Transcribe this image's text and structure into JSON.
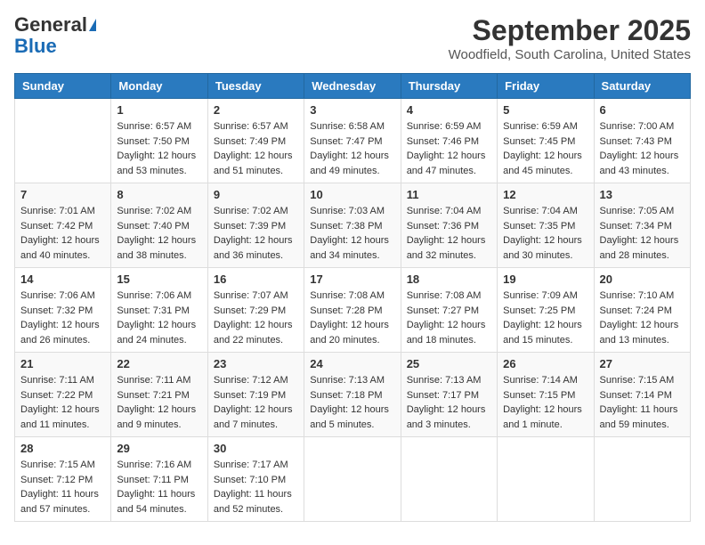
{
  "header": {
    "logo_general": "General",
    "logo_blue": "Blue",
    "month": "September 2025",
    "location": "Woodfield, South Carolina, United States"
  },
  "days_of_week": [
    "Sunday",
    "Monday",
    "Tuesday",
    "Wednesday",
    "Thursday",
    "Friday",
    "Saturday"
  ],
  "weeks": [
    [
      {
        "day": "",
        "info": ""
      },
      {
        "day": "1",
        "info": "Sunrise: 6:57 AM\nSunset: 7:50 PM\nDaylight: 12 hours\nand 53 minutes."
      },
      {
        "day": "2",
        "info": "Sunrise: 6:57 AM\nSunset: 7:49 PM\nDaylight: 12 hours\nand 51 minutes."
      },
      {
        "day": "3",
        "info": "Sunrise: 6:58 AM\nSunset: 7:47 PM\nDaylight: 12 hours\nand 49 minutes."
      },
      {
        "day": "4",
        "info": "Sunrise: 6:59 AM\nSunset: 7:46 PM\nDaylight: 12 hours\nand 47 minutes."
      },
      {
        "day": "5",
        "info": "Sunrise: 6:59 AM\nSunset: 7:45 PM\nDaylight: 12 hours\nand 45 minutes."
      },
      {
        "day": "6",
        "info": "Sunrise: 7:00 AM\nSunset: 7:43 PM\nDaylight: 12 hours\nand 43 minutes."
      }
    ],
    [
      {
        "day": "7",
        "info": "Sunrise: 7:01 AM\nSunset: 7:42 PM\nDaylight: 12 hours\nand 40 minutes."
      },
      {
        "day": "8",
        "info": "Sunrise: 7:02 AM\nSunset: 7:40 PM\nDaylight: 12 hours\nand 38 minutes."
      },
      {
        "day": "9",
        "info": "Sunrise: 7:02 AM\nSunset: 7:39 PM\nDaylight: 12 hours\nand 36 minutes."
      },
      {
        "day": "10",
        "info": "Sunrise: 7:03 AM\nSunset: 7:38 PM\nDaylight: 12 hours\nand 34 minutes."
      },
      {
        "day": "11",
        "info": "Sunrise: 7:04 AM\nSunset: 7:36 PM\nDaylight: 12 hours\nand 32 minutes."
      },
      {
        "day": "12",
        "info": "Sunrise: 7:04 AM\nSunset: 7:35 PM\nDaylight: 12 hours\nand 30 minutes."
      },
      {
        "day": "13",
        "info": "Sunrise: 7:05 AM\nSunset: 7:34 PM\nDaylight: 12 hours\nand 28 minutes."
      }
    ],
    [
      {
        "day": "14",
        "info": "Sunrise: 7:06 AM\nSunset: 7:32 PM\nDaylight: 12 hours\nand 26 minutes."
      },
      {
        "day": "15",
        "info": "Sunrise: 7:06 AM\nSunset: 7:31 PM\nDaylight: 12 hours\nand 24 minutes."
      },
      {
        "day": "16",
        "info": "Sunrise: 7:07 AM\nSunset: 7:29 PM\nDaylight: 12 hours\nand 22 minutes."
      },
      {
        "day": "17",
        "info": "Sunrise: 7:08 AM\nSunset: 7:28 PM\nDaylight: 12 hours\nand 20 minutes."
      },
      {
        "day": "18",
        "info": "Sunrise: 7:08 AM\nSunset: 7:27 PM\nDaylight: 12 hours\nand 18 minutes."
      },
      {
        "day": "19",
        "info": "Sunrise: 7:09 AM\nSunset: 7:25 PM\nDaylight: 12 hours\nand 15 minutes."
      },
      {
        "day": "20",
        "info": "Sunrise: 7:10 AM\nSunset: 7:24 PM\nDaylight: 12 hours\nand 13 minutes."
      }
    ],
    [
      {
        "day": "21",
        "info": "Sunrise: 7:11 AM\nSunset: 7:22 PM\nDaylight: 12 hours\nand 11 minutes."
      },
      {
        "day": "22",
        "info": "Sunrise: 7:11 AM\nSunset: 7:21 PM\nDaylight: 12 hours\nand 9 minutes."
      },
      {
        "day": "23",
        "info": "Sunrise: 7:12 AM\nSunset: 7:19 PM\nDaylight: 12 hours\nand 7 minutes."
      },
      {
        "day": "24",
        "info": "Sunrise: 7:13 AM\nSunset: 7:18 PM\nDaylight: 12 hours\nand 5 minutes."
      },
      {
        "day": "25",
        "info": "Sunrise: 7:13 AM\nSunset: 7:17 PM\nDaylight: 12 hours\nand 3 minutes."
      },
      {
        "day": "26",
        "info": "Sunrise: 7:14 AM\nSunset: 7:15 PM\nDaylight: 12 hours\nand 1 minute."
      },
      {
        "day": "27",
        "info": "Sunrise: 7:15 AM\nSunset: 7:14 PM\nDaylight: 11 hours\nand 59 minutes."
      }
    ],
    [
      {
        "day": "28",
        "info": "Sunrise: 7:15 AM\nSunset: 7:12 PM\nDaylight: 11 hours\nand 57 minutes."
      },
      {
        "day": "29",
        "info": "Sunrise: 7:16 AM\nSunset: 7:11 PM\nDaylight: 11 hours\nand 54 minutes."
      },
      {
        "day": "30",
        "info": "Sunrise: 7:17 AM\nSunset: 7:10 PM\nDaylight: 11 hours\nand 52 minutes."
      },
      {
        "day": "",
        "info": ""
      },
      {
        "day": "",
        "info": ""
      },
      {
        "day": "",
        "info": ""
      },
      {
        "day": "",
        "info": ""
      }
    ]
  ]
}
